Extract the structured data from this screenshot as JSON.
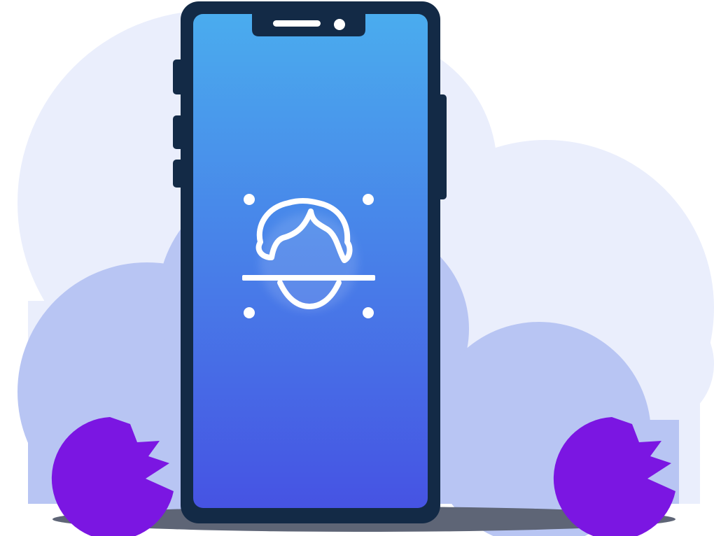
{
  "illustration": {
    "subject": "phone-face-id",
    "icon": "face-scan-icon",
    "colors": {
      "background": "#ffffff",
      "cloud_light": "#eaeefc",
      "cloud_dark": "#b8c5f3",
      "shadow": "#5e6576",
      "phone_frame": "#132a46",
      "screen_top": "#4aacee",
      "screen_bottom": "#4653e3",
      "face_icon": "#ffffff",
      "bush": "#7b16e2",
      "bush_stem": "#2e3446"
    }
  }
}
